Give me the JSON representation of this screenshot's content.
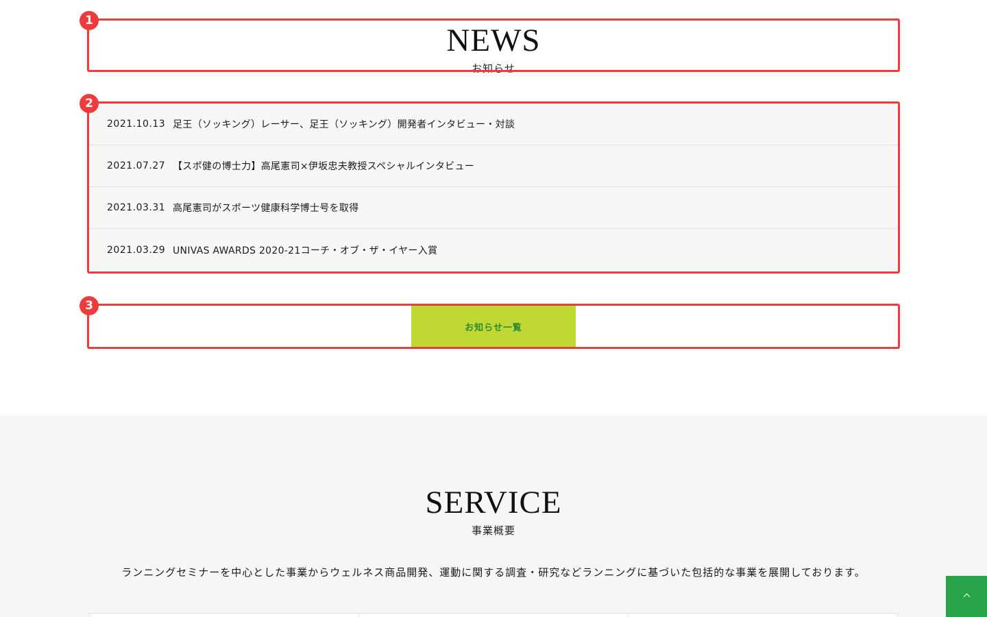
{
  "news": {
    "heading_en": "NEWS",
    "heading_jp": "お知らせ",
    "items": [
      {
        "date": "2021.10.13",
        "title": "足王（ソッキング）レーサー、足王（ソッキング）開発者インタビュー・対談"
      },
      {
        "date": "2021.07.27",
        "title": "【スポ健の博士力】高尾憲司×伊坂忠夫教授スペシャルインタビュー"
      },
      {
        "date": "2021.03.31",
        "title": "高尾憲司がスポーツ健康科学博士号を取得"
      },
      {
        "date": "2021.03.29",
        "title": "UNIVAS AWARDS 2020-21コーチ・オブ・ザ・イヤー入賞"
      }
    ],
    "more_label": "お知らせ一覧"
  },
  "service": {
    "heading_en": "SERVICE",
    "heading_jp": "事業概要",
    "description": "ランニングセミナーを中心とした事業からウェルネス商品開発、運動に関する調査・研究などランニングに基づいた包括的な事業を展開しております。"
  },
  "annotations": {
    "badge_1": "1",
    "badge_2": "2",
    "badge_3": "3"
  },
  "colors": {
    "annotation": "#ef3b3b",
    "button_bg": "#bfd834",
    "button_text": "#2f8a32",
    "to_top_bg": "#29a34a"
  },
  "icons": {
    "to_top": "chevron-up-icon"
  }
}
